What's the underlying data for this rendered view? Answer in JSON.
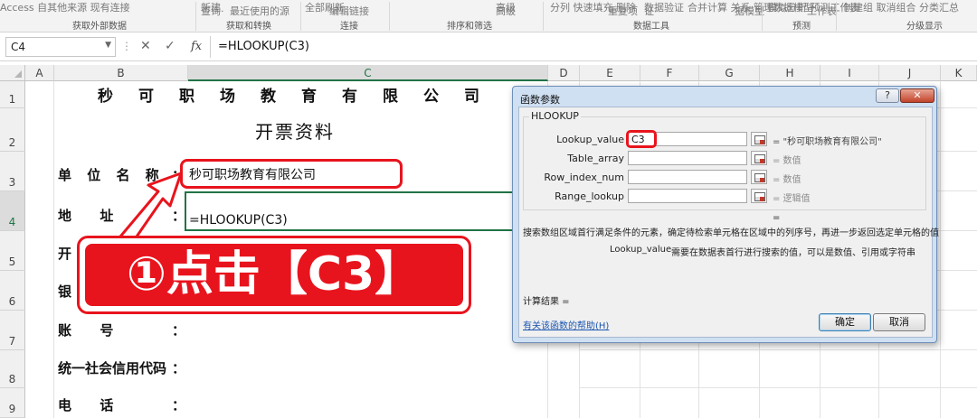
{
  "ribbon": {
    "top_labels": [
      "  Access  自其他来源  现有连接",
      "新建",
      "全部刷新",
      "",
      "高级",
      "分列  快速填充  删除",
      "数据验证",
      "合并计算  关系  管理数据模型",
      "模拟分析  预测工作表",
      "创建组  取消组合  分类汇总"
    ],
    "row2": [
      "查询·",
      "最近使用的源",
      "编辑链接",
      "高级",
      "重复项",
      "证·",
      "据模型",
      "工作表"
    ],
    "groups": [
      "获取外部数据",
      "获取和转换",
      "连接",
      "排序和筛选",
      "数据工具",
      "预测",
      "分级显示"
    ]
  },
  "formula_bar": {
    "name_box": "C4",
    "cancel_label": "✕",
    "enter_label": "✓",
    "fx_label": "fx",
    "formula": "=HLOOKUP(C3)"
  },
  "grid": {
    "columns": [
      {
        "name": "A",
        "active": false
      },
      {
        "name": "B",
        "active": false
      },
      {
        "name": "C",
        "active": true
      },
      {
        "name": "D",
        "active": false
      },
      {
        "name": "E",
        "active": false
      },
      {
        "name": "F",
        "active": false
      },
      {
        "name": "G",
        "active": false
      },
      {
        "name": "H",
        "active": false
      },
      {
        "name": "I",
        "active": false
      },
      {
        "name": "J",
        "active": false
      },
      {
        "name": "K",
        "active": false
      }
    ],
    "rows": [
      "1",
      "2",
      "3",
      "4",
      "5",
      "6",
      "7",
      "8",
      "9"
    ],
    "active_row": "4"
  },
  "sheet": {
    "title": "秒可职场教育有限公司",
    "subtitle": "开票资料",
    "labels": {
      "company_name": "单 位 名 称",
      "address": "地      址",
      "row5_char": "开",
      "row6_char": "银",
      "account": "账      号",
      "credit_code": "统一社会信用代码",
      "phone": "电      话"
    },
    "colon": "：",
    "c3_value": "秒可职场教育有限公司",
    "c4_formula": "=HLOOKUP(C3)"
  },
  "annotation": {
    "text": "①点击【C3】",
    "color": "#e8141d"
  },
  "dialog": {
    "title": "函数参数",
    "help_label": "?",
    "close_label": "✕",
    "function_name": "HLOOKUP",
    "arguments": [
      {
        "label": "Lookup_value",
        "value": "C3",
        "result": "= \"秒可职场教育有限公司\"",
        "hint": false
      },
      {
        "label": "Table_array",
        "value": "",
        "result": "= 数值",
        "hint": true
      },
      {
        "label": "Row_index_num",
        "value": "",
        "result": "= 数值",
        "hint": true
      },
      {
        "label": "Range_lookup",
        "value": "",
        "result": "= 逻辑值",
        "hint": true
      }
    ],
    "equals_sign": "=",
    "description": "搜索数组区域首行满足条件的元素，确定待检索单元格在区域中的列序号，再进一步返回选定单元格的值",
    "arg_help_name": "Lookup_value",
    "arg_help_text": "需要在数据表首行进行搜索的值，可以是数值、引用或字符串",
    "result_label": "计算结果 =",
    "help_link": "有关该函数的帮助(H)",
    "ok_label": "确定",
    "cancel_label": "取消"
  }
}
